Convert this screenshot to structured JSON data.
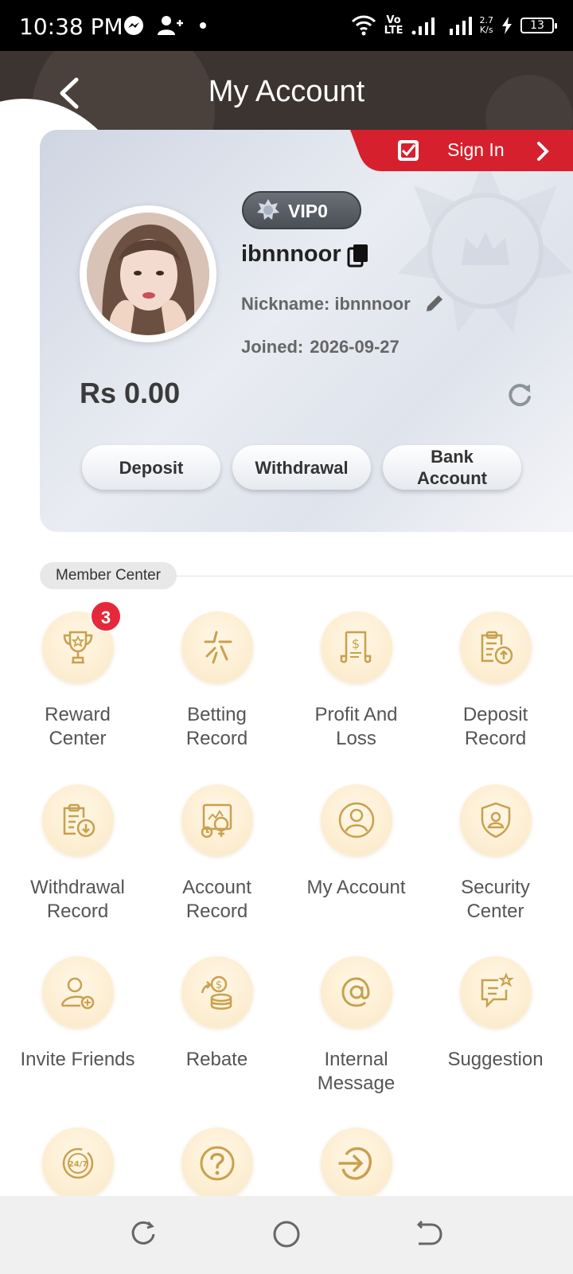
{
  "status_bar": {
    "time": "10:38 PM",
    "network_top": "Vo",
    "network_bottom": "LTE",
    "speed_value": "2.7",
    "speed_unit": "K/s",
    "battery": "13",
    "icons": [
      "messenger-icon",
      "add-user-icon",
      "dot-icon",
      "wifi-icon",
      "signal-icon",
      "signal-icon",
      "charging-icon",
      "battery-icon"
    ]
  },
  "header": {
    "title": "My Account",
    "back_icon": "chevron-left-icon"
  },
  "sign_in": {
    "label": "Sign In",
    "color": "#d6202e"
  },
  "profile": {
    "vip_level": "VIP0",
    "username": "ibnnnoor",
    "nickname": "Nickname: ibnnnoor",
    "joined_label": "Joined:",
    "joined_date": "2026-09-27",
    "balance": "Rs 0.00"
  },
  "actions": {
    "deposit": "Deposit",
    "withdrawal": "Withdrawal",
    "bank_line1": "Bank",
    "bank_line2": "Account"
  },
  "member_center": {
    "title": "Member Center",
    "accent": "#c9a04e",
    "items": [
      {
        "line1": "Reward",
        "line2": "Center",
        "icon": "trophy-icon",
        "badge": "3"
      },
      {
        "line1": "Betting",
        "line2": "Record",
        "icon": "betting-icon"
      },
      {
        "line1": "Profit And",
        "line2": "Loss",
        "icon": "receipt-dollar-icon"
      },
      {
        "line1": "Deposit",
        "line2": "Record",
        "icon": "clipboard-up-icon"
      },
      {
        "line1": "Withdrawal",
        "line2": "Record",
        "icon": "clipboard-down-icon"
      },
      {
        "line1": "Account",
        "line2": "Record",
        "icon": "account-record-icon"
      },
      {
        "line1": "My Account",
        "line2": "",
        "icon": "user-circle-icon"
      },
      {
        "line1": "Security",
        "line2": "Center",
        "icon": "shield-user-icon"
      },
      {
        "line1": "Invite Friends",
        "line2": "",
        "icon": "invite-user-icon"
      },
      {
        "line1": "Rebate",
        "line2": "",
        "icon": "coins-icon"
      },
      {
        "line1": "Internal",
        "line2": "Message",
        "icon": "at-icon"
      },
      {
        "line1": "Suggestion",
        "line2": "",
        "icon": "chat-star-icon"
      },
      {
        "line1": "",
        "line2": "",
        "icon": "support-24-7-icon"
      },
      {
        "line1": "",
        "line2": "",
        "icon": "help-icon"
      },
      {
        "line1": "",
        "line2": "",
        "icon": "logout-icon"
      }
    ]
  },
  "nav_bar": {
    "icons": [
      "recents-icon",
      "home-icon",
      "back-icon"
    ]
  }
}
